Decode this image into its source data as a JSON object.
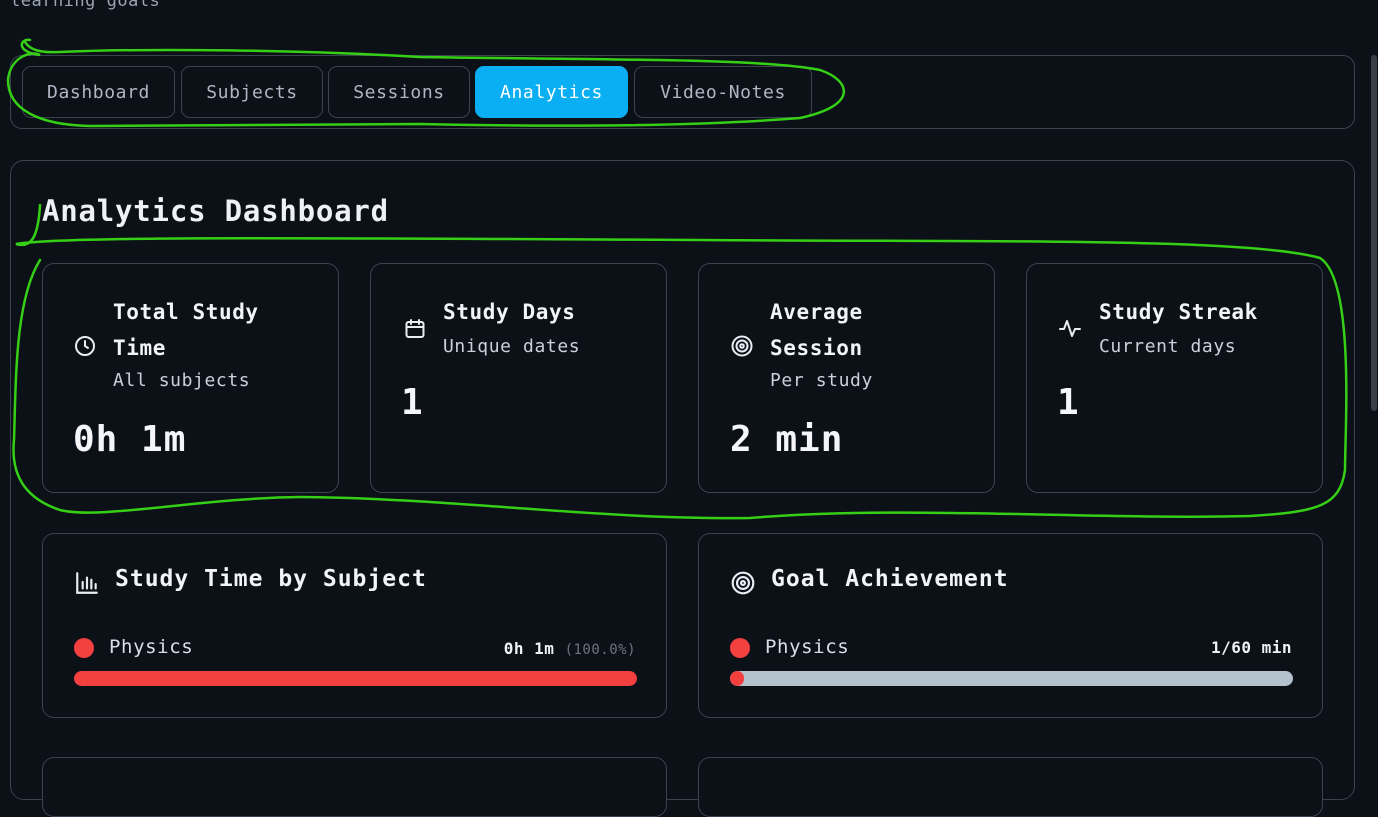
{
  "header": {
    "subtitle": "learning goals"
  },
  "tabs": [
    {
      "label": "Dashboard",
      "active": false
    },
    {
      "label": "Subjects",
      "active": false
    },
    {
      "label": "Sessions",
      "active": false
    },
    {
      "label": "Analytics",
      "active": true
    },
    {
      "label": "Video-Notes",
      "active": false
    }
  ],
  "analytics": {
    "title": "Analytics Dashboard",
    "stats": [
      {
        "icon": "clock-icon",
        "title_line1": "Total Study",
        "title_line2": "Time",
        "subtitle": "All subjects",
        "value": "0h 1m"
      },
      {
        "icon": "calendar-icon",
        "title_line1": "Study Days",
        "title_line2": "",
        "subtitle": "Unique dates",
        "value": "1"
      },
      {
        "icon": "target-icon",
        "title_line1": "Average",
        "title_line2": "Session",
        "subtitle": "Per study",
        "value": "2 min"
      },
      {
        "icon": "activity-icon",
        "title_line1": "Study Streak",
        "title_line2": "",
        "subtitle": "Current days",
        "value": "1"
      }
    ],
    "study_time": {
      "title": "Study Time by Subject",
      "icon": "bar-chart-icon",
      "items": [
        {
          "subject": "Physics",
          "time": "0h 1m",
          "percent": "(100.0%)",
          "fraction": 1.0,
          "color": "#f43f3f"
        }
      ]
    },
    "goal_achievement": {
      "title": "Goal Achievement",
      "icon": "target-icon",
      "items": [
        {
          "subject": "Physics",
          "progress": "1/60 min",
          "fraction": 0.0167,
          "color": "#f43f3f",
          "track_color": "#b3c2cc"
        }
      ]
    }
  },
  "colors": {
    "accent": "#0aaef2",
    "background": "#0c1017",
    "border": "#3a4350",
    "annotation": "#35d016"
  }
}
